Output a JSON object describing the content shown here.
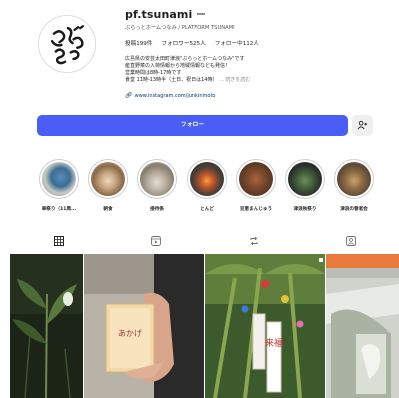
{
  "profile": {
    "username": "pf.tsunami",
    "full_name": "ぶらっとホームつなみ / PLATFORM TSUNAMI",
    "stats": {
      "posts": "投稿199件",
      "followers": "フォロワー525人",
      "following": "フォロー中112人"
    },
    "bio_lines": [
      "広島県の安芸太田町津浪\"ぶらっとホームつなみ\"です",
      "産直野菜の入荷情報から地域情報なども発信！",
      "営業時間は8時-17時です",
      "食堂 11時-13時半（土日、祝日は14時）"
    ],
    "bio_more": "... 続きを読む",
    "link": "www.instagram.com/junkinmoto",
    "avatar_icon": "brand-logo-icon"
  },
  "actions": {
    "follow_label": "フォロー",
    "suggest_icon": "add-person-icon"
  },
  "highlights": [
    {
      "label": "車祭り（11周..."
    },
    {
      "label": "朝食"
    },
    {
      "label": "接待係"
    },
    {
      "label": "とんど"
    },
    {
      "label": "豆恵まんじゅう"
    },
    {
      "label": "津浪秋祭り"
    },
    {
      "label": "津浪の春者会"
    }
  ],
  "tabs": [
    {
      "name": "posts",
      "icon": "grid-icon",
      "active": true
    },
    {
      "name": "reels",
      "icon": "reels-icon",
      "active": false
    },
    {
      "name": "reposts",
      "icon": "repost-icon",
      "active": false
    },
    {
      "name": "tagged",
      "icon": "tagged-icon",
      "active": false
    }
  ],
  "posts": [
    {
      "kind": "plant-photo"
    },
    {
      "kind": "package-photo",
      "caption": "あかげ"
    },
    {
      "kind": "bamboo-decoration-photo",
      "caption": "来福"
    },
    {
      "kind": "building-photo"
    }
  ],
  "colors": {
    "accent": "#4a5df7",
    "link": "#00376b",
    "muted": "#8e8e8e"
  }
}
